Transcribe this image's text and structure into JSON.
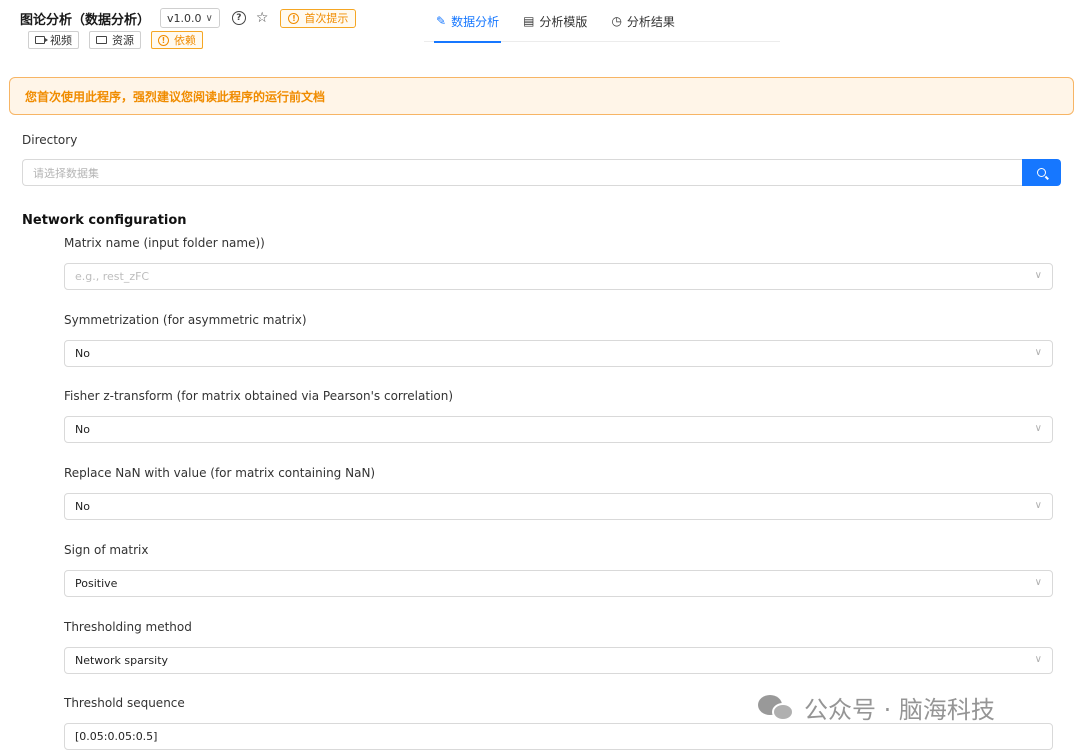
{
  "header": {
    "title": "图论分析（数据分析）",
    "version": "v1.0.0",
    "first_tip": "首次提示",
    "buttons": {
      "video": "视频",
      "resources": "资源",
      "dependencies": "依赖"
    }
  },
  "nav": {
    "tabs": [
      {
        "label": "数据分析",
        "icon": "edit-icon",
        "active": true
      },
      {
        "label": "分析模版",
        "icon": "document-icon",
        "active": false
      },
      {
        "label": "分析结果",
        "icon": "history-icon",
        "active": false
      }
    ]
  },
  "alert": {
    "text": "您首次使用此程序，强烈建议您阅读此程序的运行前文档"
  },
  "directory": {
    "label": "Directory",
    "placeholder": "请选择数据集"
  },
  "network": {
    "title": "Network configuration",
    "fields": [
      {
        "label": "Matrix name (input folder name))",
        "value": "e.g., rest_zFC",
        "is_placeholder": true,
        "type": "select"
      },
      {
        "label": "Symmetrization (for asymmetric matrix)",
        "value": "No",
        "type": "select"
      },
      {
        "label": "Fisher z-transform (for matrix obtained via Pearson's correlation)",
        "value": "No",
        "type": "select"
      },
      {
        "label": "Replace NaN with value (for matrix containing NaN)",
        "value": "No",
        "type": "select"
      },
      {
        "label": "Sign of matrix",
        "value": "Positive",
        "type": "select"
      },
      {
        "label": "Thresholding method",
        "value": "Network sparsity",
        "type": "select"
      },
      {
        "label": "Threshold sequence",
        "value": "[0.05:0.05:0.5]",
        "type": "text"
      }
    ]
  },
  "watermark": {
    "text": "公众号 · 脑海科技"
  },
  "colors": {
    "accent": "#1677ff",
    "warning": "#f08c00",
    "alert_bg": "#fff5e8"
  }
}
